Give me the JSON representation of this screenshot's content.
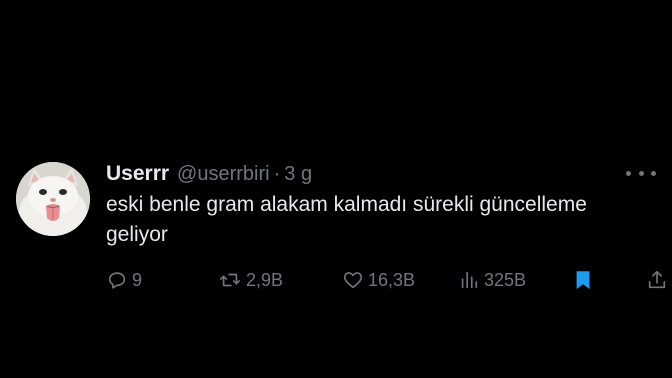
{
  "tweet": {
    "display_name": "Userrr",
    "handle": "@userrbiri",
    "separator": "·",
    "timestamp": "3 g",
    "text": "eski benle gram alakam kalmadı sürekli güncelleme geliyor",
    "more_icon": "more-horizontal-icon",
    "avatar_icon": "cat-avatar"
  },
  "actions": {
    "reply": {
      "icon": "reply-icon",
      "count": "9"
    },
    "retweet": {
      "icon": "retweet-icon",
      "count": "2,9B"
    },
    "like": {
      "icon": "heart-icon",
      "count": "16,3B"
    },
    "views": {
      "icon": "views-icon",
      "count": "325B"
    },
    "bookmark": {
      "icon": "bookmark-icon",
      "active_color": "#1d9bf0"
    },
    "share": {
      "icon": "share-icon"
    }
  },
  "colors": {
    "background": "#000000",
    "primary_text": "#e7e9ea",
    "secondary_text": "#71767b",
    "accent": "#1d9bf0"
  }
}
